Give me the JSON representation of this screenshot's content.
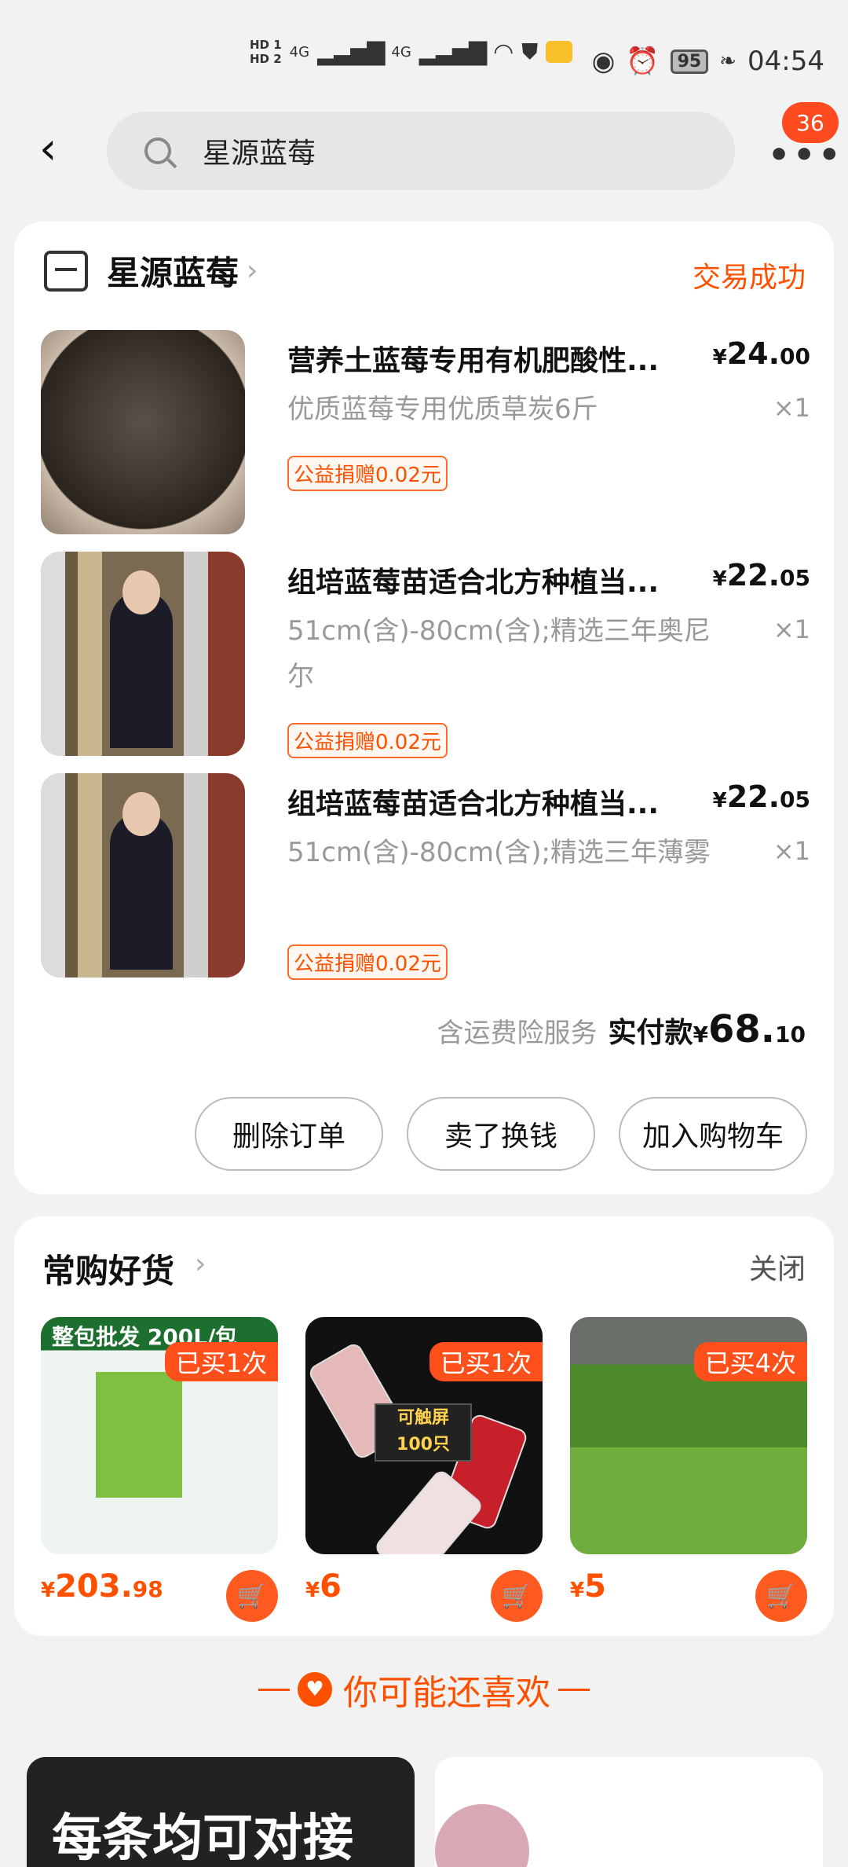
{
  "status_bar": {
    "time": "04:54",
    "battery": "95",
    "hd1": "HD 1",
    "hd2": "HD 2",
    "net": "4G"
  },
  "header": {
    "search_text": "星源蓝莓",
    "badge_count": "36"
  },
  "order": {
    "shop_name": "星源蓝莓",
    "status": "交易成功",
    "items": [
      {
        "title": "营养土蓝莓专用有机肥酸性...",
        "spec": "优质蓝莓专用优质草炭6斤",
        "price_cur": "¥",
        "price_int": "24.",
        "price_dec": "00",
        "qty": "×1",
        "donation": "公益捐赠0.02元"
      },
      {
        "title": "组培蓝莓苗适合北方种植当...",
        "spec": "51cm(含)-80cm(含);精选三年奥尼尔",
        "price_cur": "¥",
        "price_int": "22.",
        "price_dec": "05",
        "qty": "×1",
        "donation": "公益捐赠0.02元"
      },
      {
        "title": "组培蓝莓苗适合北方种植当...",
        "spec": "51cm(含)-80cm(含);精选三年薄雾",
        "price_cur": "¥",
        "price_int": "22.",
        "price_dec": "05",
        "qty": "×1",
        "donation": "公益捐赠0.02元"
      }
    ],
    "total_note": "含运费险服务",
    "total_label": "实付款",
    "total_cur": "¥",
    "total_int": "68.",
    "total_dec": "10",
    "buttons": {
      "delete": "删除订单",
      "sell": "卖了换钱",
      "add_cart": "加入购物车"
    }
  },
  "frequent": {
    "title": "常购好货",
    "close": "关闭",
    "products": [
      {
        "bought": "已买1次",
        "price_cur": "¥",
        "price_int": "203.",
        "price_dec": "98",
        "top_text": "整包批发  200L/包"
      },
      {
        "bought": "已买1次",
        "price_cur": "¥",
        "price_int": "6",
        "price_dec": "",
        "label_line1": "可触屏",
        "label_line2": "100只"
      },
      {
        "bought": "已买4次",
        "price_cur": "¥",
        "price_int": "5",
        "price_dec": ""
      }
    ]
  },
  "recommend": {
    "title": "你可能还喜欢",
    "card1_text": "每条均可对接"
  },
  "colors": {
    "accent": "#ff5000",
    "card": "#ffffff",
    "background": "#f2f2f2"
  },
  "icons": {
    "back": "back-arrow-icon",
    "search": "search-icon",
    "more": "more-icon",
    "shop": "shop-icon",
    "cart": "cart-icon",
    "heart": "heart-icon"
  }
}
